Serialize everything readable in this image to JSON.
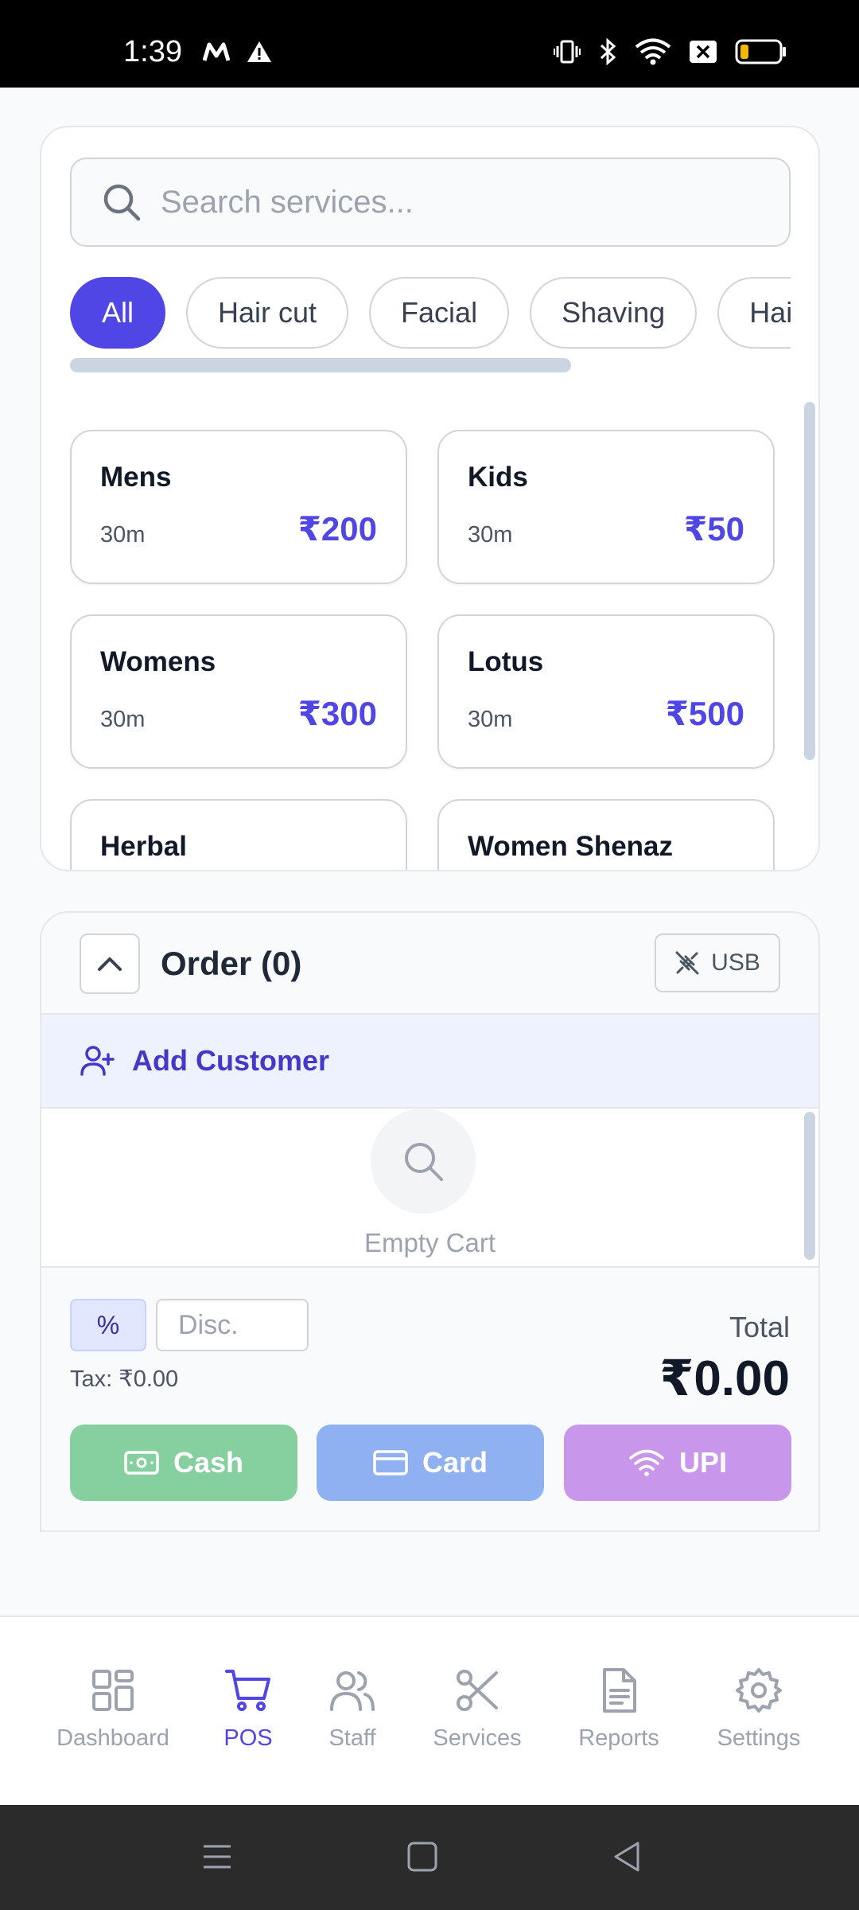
{
  "status_bar": {
    "time": "1:39",
    "icons": [
      "m-icon",
      "warning-icon",
      "vibrate-icon",
      "bluetooth-icon",
      "wifi-icon",
      "no-sim-icon",
      "battery-low-icon"
    ]
  },
  "search": {
    "placeholder": "Search services..."
  },
  "categories": [
    "All",
    "Hair cut",
    "Facial",
    "Shaving",
    "Hair"
  ],
  "active_category": "All",
  "services": [
    {
      "name": "Mens",
      "duration": "30m",
      "price": "₹200"
    },
    {
      "name": "Kids",
      "duration": "30m",
      "price": "₹50"
    },
    {
      "name": "Womens",
      "duration": "30m",
      "price": "₹300"
    },
    {
      "name": "Lotus",
      "duration": "30m",
      "price": "₹500"
    },
    {
      "name": "Herbal",
      "duration": "",
      "price": ""
    },
    {
      "name": "Women Shenaz",
      "duration": "",
      "price": ""
    }
  ],
  "order": {
    "title": "Order (0)",
    "usb_label": "USB",
    "add_customer_label": "Add Customer",
    "empty_cart_label": "Empty Cart",
    "discount_type_label": "%",
    "discount_placeholder": "Disc.",
    "tax_label": "Tax: ₹0.00",
    "total_label": "Total",
    "total_value": "₹0.00",
    "pay_cash_label": "Cash",
    "pay_card_label": "Card",
    "pay_upi_label": "UPI"
  },
  "nav": {
    "items": [
      {
        "label": "Dashboard",
        "icon": "grid-icon"
      },
      {
        "label": "POS",
        "icon": "cart-icon"
      },
      {
        "label": "Staff",
        "icon": "users-icon"
      },
      {
        "label": "Services",
        "icon": "scissors-icon"
      },
      {
        "label": "Reports",
        "icon": "file-icon"
      },
      {
        "label": "Settings",
        "icon": "gear-icon"
      }
    ],
    "active": "POS"
  },
  "colors": {
    "accent": "#4f46e5",
    "cash": "#86cf9f",
    "card": "#8fb1f1",
    "upi": "#c897ec"
  }
}
